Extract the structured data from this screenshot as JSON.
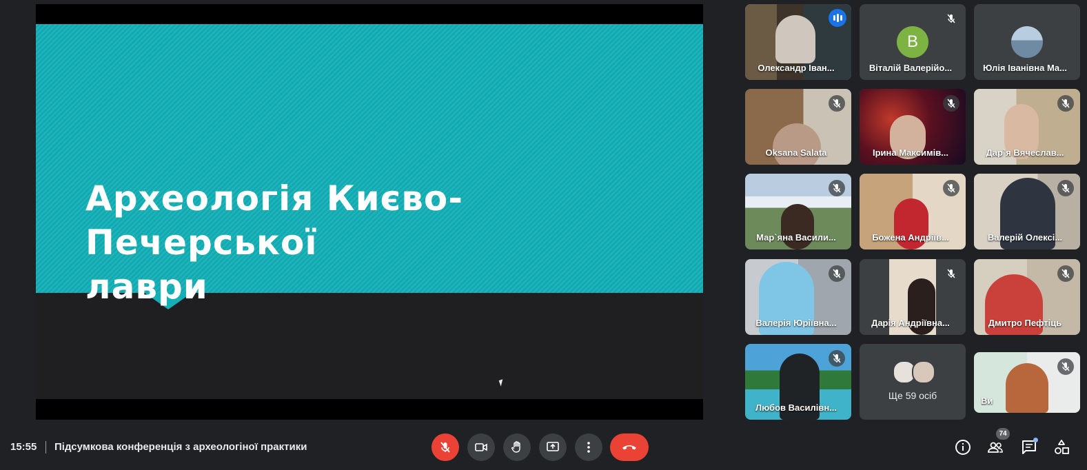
{
  "presentation": {
    "slide_title_line1": "Археологія Києво-Печерської",
    "slide_title_line2": "лаври",
    "slide_color": "#13b0b6"
  },
  "participants": [
    {
      "name": "Олександр Іван...",
      "speaking": true
    },
    {
      "name": "Віталій Валерійо...",
      "avatar_letter": "В",
      "muted": true
    },
    {
      "name": "Юлія Іванівна Ма...",
      "muted": true
    },
    {
      "name": "Oksana Salata",
      "muted": true
    },
    {
      "name": "Ірина Максимів...",
      "muted": true
    },
    {
      "name": "Дар`я Вячеслав...",
      "muted": true
    },
    {
      "name": "Мар`яна Васили...",
      "muted": true
    },
    {
      "name": "Божена Андріїв...",
      "muted": true
    },
    {
      "name": "Валерій Олексі...",
      "muted": true
    },
    {
      "name": "Валерія Юріївна...",
      "muted": true
    },
    {
      "name": "Дарія Андріївна...",
      "muted": true
    },
    {
      "name": "Дмитро Пефтіць",
      "muted": true
    },
    {
      "name": "Любов Василівн...",
      "muted": true
    },
    {
      "name": "Ще 59 осіб"
    },
    {
      "name": "Ви",
      "muted": true
    }
  ],
  "bottom_bar": {
    "time": "15:55",
    "meeting_title": "Підсумкова конференція з археологіної практики",
    "people_count": "74"
  },
  "icons": {
    "mic": "mic-off-icon",
    "camera": "videocam-icon",
    "hand": "raise-hand-icon",
    "present": "present-screen-icon",
    "more": "more-vert-icon",
    "end": "call-end-icon",
    "info": "info-icon",
    "people": "people-icon",
    "chat": "chat-icon",
    "activities": "activities-icon"
  },
  "colors": {
    "background": "#202124",
    "tile": "#3c4043",
    "red": "#ea4335",
    "accent": "#8ab4f8"
  }
}
